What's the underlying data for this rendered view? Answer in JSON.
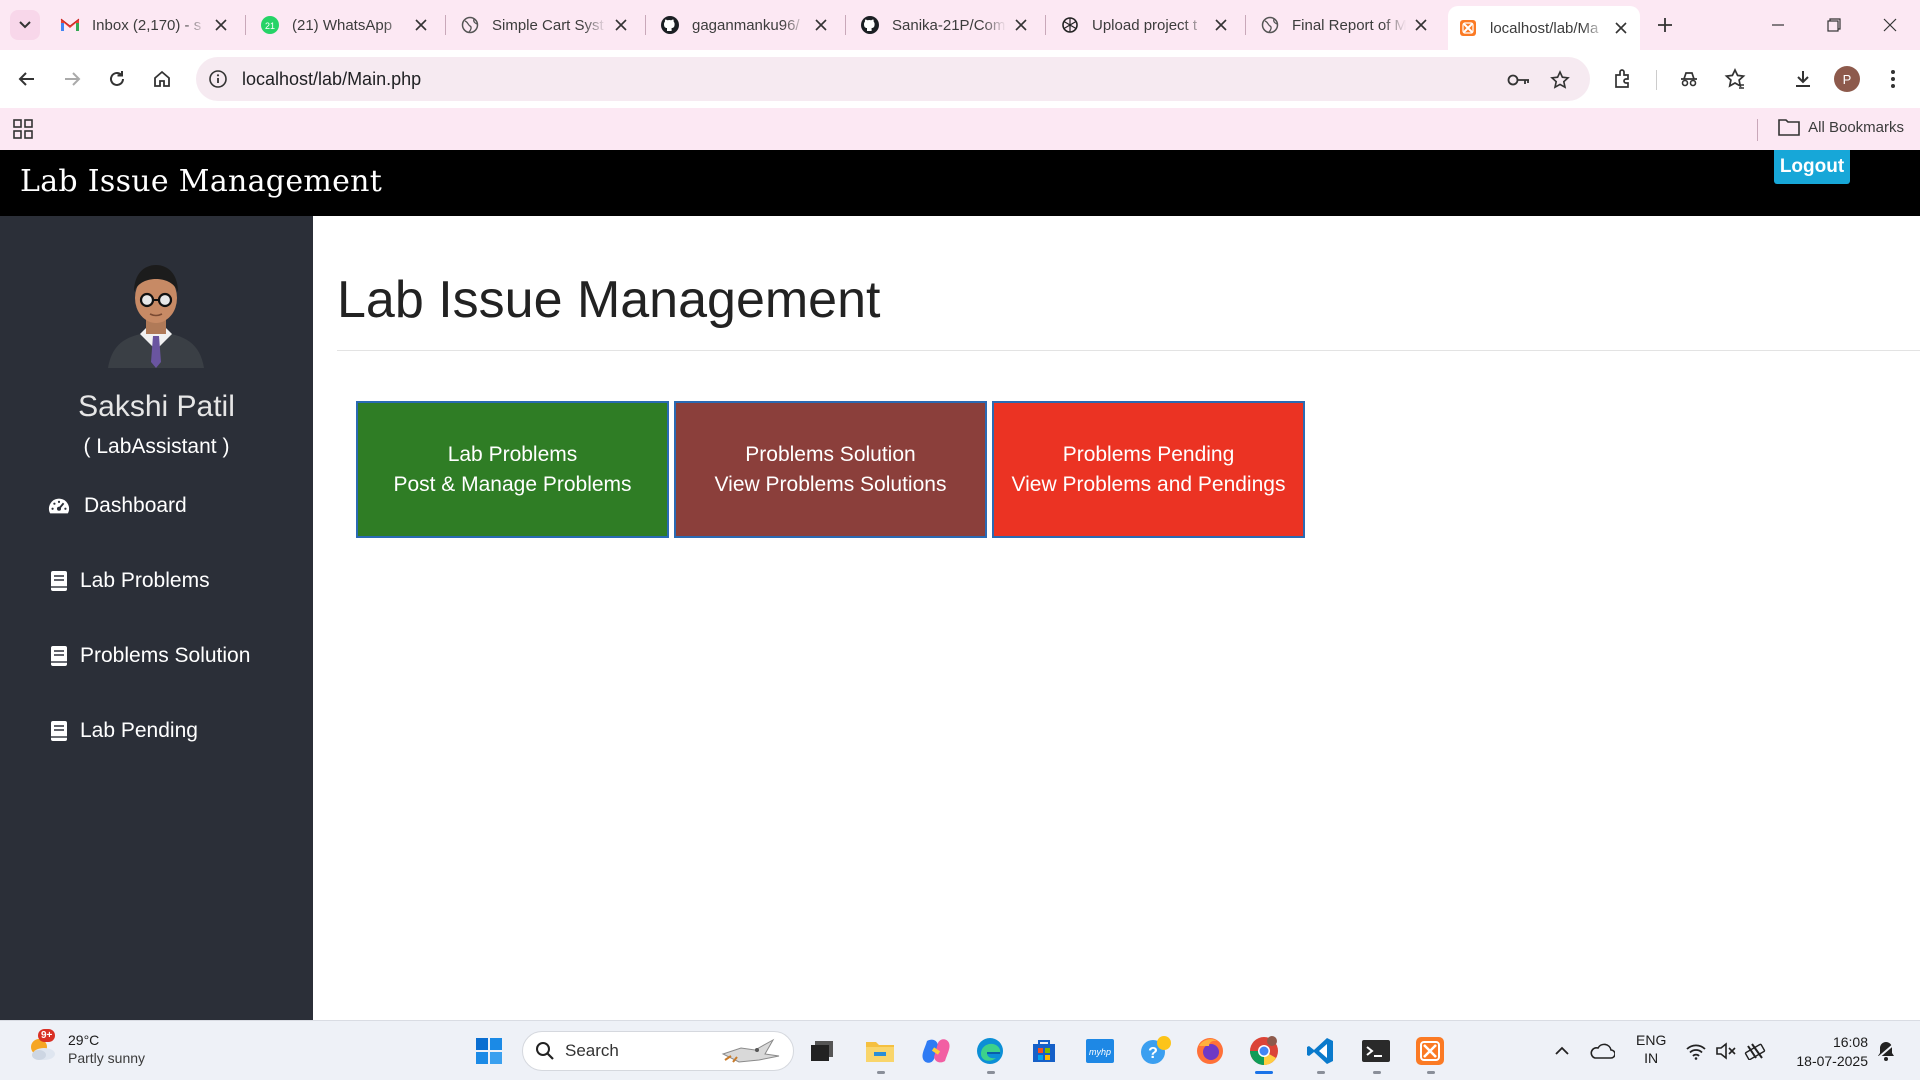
{
  "browser": {
    "tabs": [
      {
        "title": "Inbox (2,170) - s",
        "icon": "gmail-icon"
      },
      {
        "title": "(21) WhatsApp",
        "icon": "whatsapp-icon"
      },
      {
        "title": "Simple Cart Syst",
        "icon": "globe-icon"
      },
      {
        "title": "gaganmanku96/",
        "icon": "github-icon"
      },
      {
        "title": "Sanika-21P/Com",
        "icon": "github-icon"
      },
      {
        "title": "Upload project t",
        "icon": "openai-icon"
      },
      {
        "title": "Final Report of M",
        "icon": "globe-icon"
      },
      {
        "title": "localhost/lab/Ma",
        "icon": "xampp-icon",
        "active": true
      }
    ],
    "url": "localhost/lab/Main.php",
    "bookmarks_label": "All Bookmarks",
    "profile_initial": "P",
    "whatsapp_badge": "21"
  },
  "app": {
    "brand": "Lab Issue Management",
    "logout_label": "Logout",
    "user": {
      "name": "Sakshi Patil",
      "role": "( LabAssistant )"
    },
    "sidebar": [
      {
        "label": "Dashboard",
        "icon": "dashboard-icon"
      },
      {
        "label": "Lab Problems",
        "icon": "book-icon"
      },
      {
        "label": "Problems Solution",
        "icon": "book-icon"
      },
      {
        "label": "Lab Pending",
        "icon": "book-icon"
      }
    ],
    "page_title": "Lab Issue Management",
    "cards": [
      {
        "title": "Lab Problems",
        "subtitle": "Post & Manage Problems",
        "color": "#2f7d25"
      },
      {
        "title": "Problems Solution",
        "subtitle": "View Problems Solutions",
        "color": "#8b3f3b"
      },
      {
        "title": "Problems Pending",
        "subtitle": "View Problems and Pendings",
        "color": "#eb3323"
      }
    ]
  },
  "taskbar": {
    "weather_badge": "9+",
    "temperature": "29°C",
    "weather": "Partly sunny",
    "search_label": "Search",
    "language": "ENG",
    "region": "IN",
    "time": "16:08",
    "date": "18-07-2025"
  }
}
